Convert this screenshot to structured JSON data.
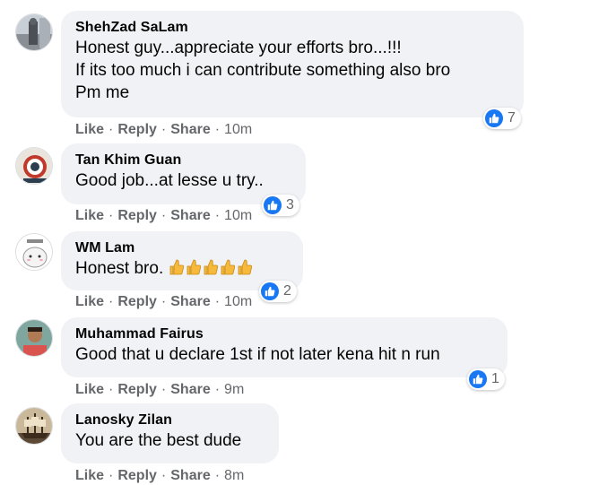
{
  "labels": {
    "like": "Like",
    "reply": "Reply",
    "share": "Share",
    "dot": "·"
  },
  "colors": {
    "reaction_blue": "#1877f2",
    "bubble_bg": "#f0f2f5",
    "meta_gray": "#65676b"
  },
  "comments": [
    {
      "author": "ShehZad SaLam",
      "lines": [
        "Honest guy...appreciate your efforts bro...!!!",
        "If its too much i can contribute something also bro",
        "Pm me"
      ],
      "time": "10m",
      "reaction_count": "7",
      "reaction_icon": "like-icon"
    },
    {
      "author": "Tan Khim Guan",
      "lines": [
        "Good job...at lesse u try.."
      ],
      "time": "10m",
      "reaction_count": "3",
      "reaction_icon": "like-icon"
    },
    {
      "author": "WM Lam",
      "lines": [
        "Honest bro."
      ],
      "emoji": "thumbs-up-emoji x5",
      "time": "10m",
      "reaction_count": "2",
      "reaction_icon": "like-icon"
    },
    {
      "author": "Muhammad Fairus",
      "lines": [
        "Good that u declare 1st if not later kena hit n run"
      ],
      "time": "9m",
      "reaction_count": "1",
      "reaction_icon": "like-icon"
    },
    {
      "author": "Lanosky Zilan",
      "lines": [
        "You are the best dude"
      ],
      "time": "8m"
    }
  ]
}
